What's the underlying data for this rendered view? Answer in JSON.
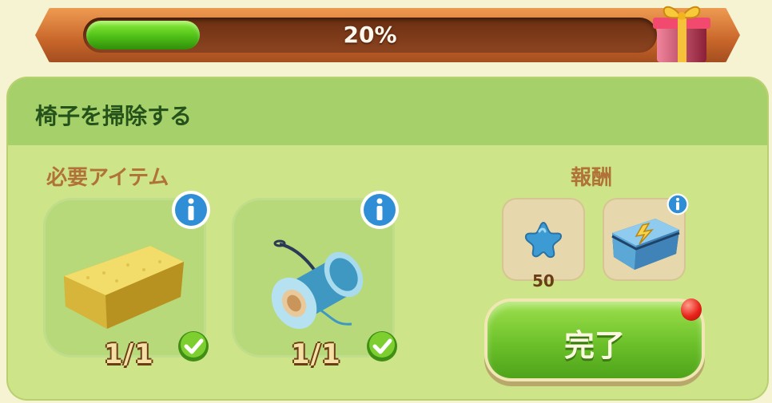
{
  "progress": {
    "label": "20%",
    "fraction": 0.2
  },
  "task": {
    "title": "椅子を掃除する"
  },
  "required": {
    "label": "必要アイテム",
    "items": [
      {
        "icon": "sponge-icon",
        "count": "1/1"
      },
      {
        "icon": "thread-spool-icon",
        "count": "1/1"
      }
    ]
  },
  "rewards": {
    "label": "報酬",
    "items": [
      {
        "icon": "blue-star-icon",
        "count": "50"
      },
      {
        "icon": "energy-chest-icon"
      }
    ]
  },
  "complete_button": {
    "label": "完了"
  },
  "colors": {
    "accent_green": "#6cc12a",
    "bar_orange": "#c8662a",
    "title_green": "#24521a"
  }
}
